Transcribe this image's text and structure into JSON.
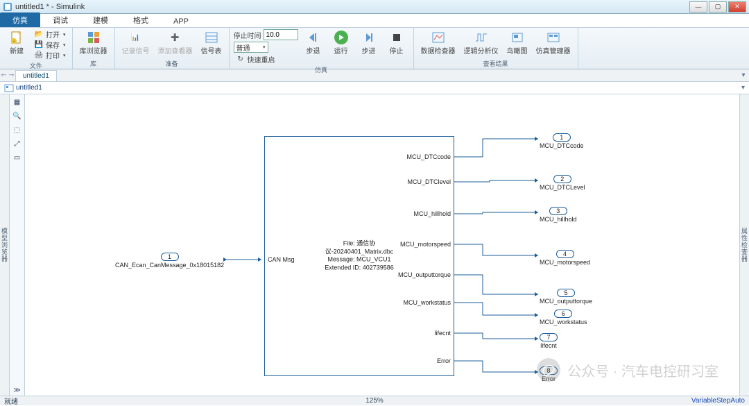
{
  "window": {
    "title": "untitled1 * - Simulink"
  },
  "tabs": {
    "sim": "仿真",
    "debug": "调试",
    "model": "建模",
    "format": "格式",
    "app": "APP"
  },
  "ribbon": {
    "file": {
      "new": "新建",
      "open": "打开",
      "save": "保存",
      "print": "打印",
      "group": "文件"
    },
    "lib": {
      "browser": "库浏览器",
      "group": "库"
    },
    "prep": {
      "logsig": "记录信号",
      "addviewer": "添加查看器",
      "siganalyzer": "信号表",
      "group": "准备"
    },
    "simctrl": {
      "stoptime_lbl": "停止时间",
      "stoptime_val": "10.0",
      "mode": "普通",
      "fastrestart": "快速重启",
      "back": "步退",
      "run": "运行",
      "fwd": "步进",
      "stop": "停止",
      "group": "仿真"
    },
    "review": {
      "datainsp": "数据检查器",
      "logic": "逻辑分析仪",
      "birdseye": "鸟瞰图",
      "simmgr": "仿真管理器",
      "group": "查看结果"
    }
  },
  "doc": {
    "tab": "untitled1",
    "crumb": "untitled1"
  },
  "model": {
    "input": {
      "num": "1",
      "label": "CAN_Ecan_CanMessage_0x18015182"
    },
    "block": {
      "in_label": "CAN Msg",
      "line1": "File: 通信协议-20240401_Matrix.dbc",
      "line2": "Message: MCU_VCU1",
      "line3": "Extended ID: 402739586",
      "outs": [
        "MCU_DTCcode",
        "MCU_DTClevel",
        "MCU_hillhold",
        "MCU_motorspeed",
        "MCU_outputtorque",
        "MCU_workstatus",
        "lifecnt",
        "Error"
      ]
    },
    "outputs": [
      {
        "num": "1",
        "label": "MCU_DTCcode"
      },
      {
        "num": "2",
        "label": "MCU_DTCLevel"
      },
      {
        "num": "3",
        "label": "MCU_hillhold"
      },
      {
        "num": "4",
        "label": "MCU_motorspeed"
      },
      {
        "num": "5",
        "label": "MCU_outputtorque"
      },
      {
        "num": "6",
        "label": "MCU_workstatus"
      },
      {
        "num": "7",
        "label": "lifecnt"
      },
      {
        "num": "8",
        "label": "Error"
      }
    ]
  },
  "status": {
    "ready": "就绪",
    "zoom": "125%",
    "solver": "VariableStepAuto"
  },
  "watermark": "公众号 · 汽车电控研习室"
}
